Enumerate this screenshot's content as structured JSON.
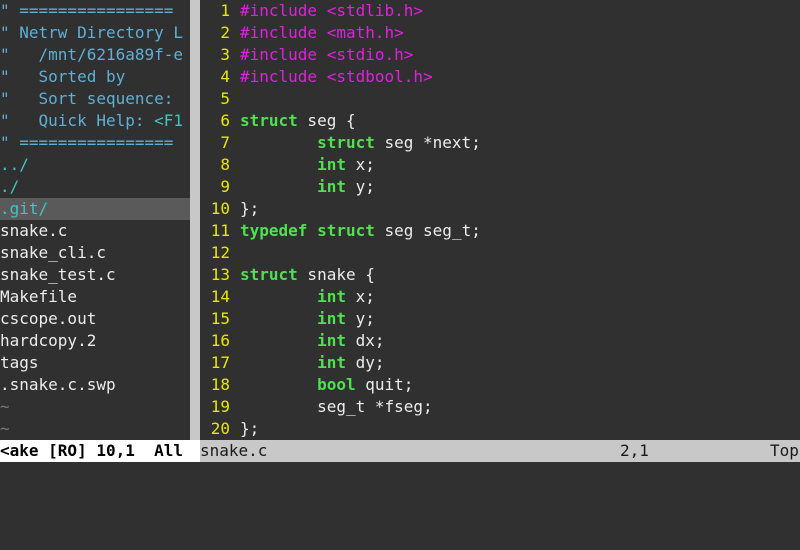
{
  "netrw": {
    "header_lines": [
      "\" ================",
      "\" Netrw Directory L",
      "\"   /mnt/6216a89f-e",
      "\"   Sorted by",
      "\"   Sort sequence:",
      "\"   Quick Help: ",
      "\" ================"
    ],
    "quick_help_key": "<F1",
    "entries": [
      {
        "name": "../",
        "kind": "dir"
      },
      {
        "name": "./",
        "kind": "dir"
      },
      {
        "name": ".git/",
        "kind": "dir",
        "selected": true
      },
      {
        "name": "snake.c",
        "kind": "file"
      },
      {
        "name": "snake_cli.c",
        "kind": "file"
      },
      {
        "name": "snake_test.c",
        "kind": "file"
      },
      {
        "name": "Makefile",
        "kind": "file"
      },
      {
        "name": "cscope.out",
        "kind": "file"
      },
      {
        "name": "hardcopy.2",
        "kind": "file"
      },
      {
        "name": "tags",
        "kind": "file"
      },
      {
        "name": ".snake.c.swp",
        "kind": "file"
      }
    ],
    "tildes": [
      "~",
      "~"
    ]
  },
  "editor": {
    "lines": [
      {
        "n": "1",
        "tokens": [
          {
            "t": "#include",
            "c": "pre"
          },
          {
            "t": " ",
            "c": "norm"
          },
          {
            "t": "<stdlib.h>",
            "c": "str"
          }
        ]
      },
      {
        "n": "2",
        "tokens": [
          {
            "t": "#include",
            "c": "pre"
          },
          {
            "t": " ",
            "c": "norm"
          },
          {
            "t": "<math.h>",
            "c": "str"
          }
        ]
      },
      {
        "n": "3",
        "tokens": [
          {
            "t": "#include",
            "c": "pre"
          },
          {
            "t": " ",
            "c": "norm"
          },
          {
            "t": "<stdio.h>",
            "c": "str"
          }
        ]
      },
      {
        "n": "4",
        "tokens": [
          {
            "t": "#include",
            "c": "pre"
          },
          {
            "t": " ",
            "c": "norm"
          },
          {
            "t": "<stdbool.h>",
            "c": "str"
          }
        ]
      },
      {
        "n": "5",
        "tokens": []
      },
      {
        "n": "6",
        "tokens": [
          {
            "t": "struct",
            "c": "kw"
          },
          {
            "t": " seg {",
            "c": "norm"
          }
        ]
      },
      {
        "n": "7",
        "tokens": [
          {
            "t": "        ",
            "c": "norm"
          },
          {
            "t": "struct",
            "c": "kw"
          },
          {
            "t": " seg *next;",
            "c": "norm"
          }
        ]
      },
      {
        "n": "8",
        "tokens": [
          {
            "t": "        ",
            "c": "norm"
          },
          {
            "t": "int",
            "c": "ty"
          },
          {
            "t": " x;",
            "c": "norm"
          }
        ]
      },
      {
        "n": "9",
        "tokens": [
          {
            "t": "        ",
            "c": "norm"
          },
          {
            "t": "int",
            "c": "ty"
          },
          {
            "t": " y;",
            "c": "norm"
          }
        ]
      },
      {
        "n": "10",
        "tokens": [
          {
            "t": "};",
            "c": "norm"
          }
        ]
      },
      {
        "n": "11",
        "tokens": [
          {
            "t": "typedef",
            "c": "kw"
          },
          {
            "t": " ",
            "c": "norm"
          },
          {
            "t": "struct",
            "c": "kw"
          },
          {
            "t": " seg seg_t;",
            "c": "norm"
          }
        ]
      },
      {
        "n": "12",
        "tokens": []
      },
      {
        "n": "13",
        "tokens": [
          {
            "t": "struct",
            "c": "kw"
          },
          {
            "t": " snake {",
            "c": "norm"
          }
        ]
      },
      {
        "n": "14",
        "tokens": [
          {
            "t": "        ",
            "c": "norm"
          },
          {
            "t": "int",
            "c": "ty"
          },
          {
            "t": " x;",
            "c": "norm"
          }
        ]
      },
      {
        "n": "15",
        "tokens": [
          {
            "t": "        ",
            "c": "norm"
          },
          {
            "t": "int",
            "c": "ty"
          },
          {
            "t": " y;",
            "c": "norm"
          }
        ]
      },
      {
        "n": "16",
        "tokens": [
          {
            "t": "        ",
            "c": "norm"
          },
          {
            "t": "int",
            "c": "ty"
          },
          {
            "t": " dx;",
            "c": "norm"
          }
        ]
      },
      {
        "n": "17",
        "tokens": [
          {
            "t": "        ",
            "c": "norm"
          },
          {
            "t": "int",
            "c": "ty"
          },
          {
            "t": " dy;",
            "c": "norm"
          }
        ]
      },
      {
        "n": "18",
        "tokens": [
          {
            "t": "        ",
            "c": "norm"
          },
          {
            "t": "bool",
            "c": "ty"
          },
          {
            "t": " quit;",
            "c": "norm"
          }
        ]
      },
      {
        "n": "19",
        "tokens": [
          {
            "t": "        seg_t *fseg;",
            "c": "norm"
          }
        ]
      },
      {
        "n": "20",
        "tokens": [
          {
            "t": "};",
            "c": "norm"
          }
        ]
      }
    ]
  },
  "statusline": {
    "left": "<ake [RO] 10,1  All",
    "right_file": "snake.c",
    "right_pos": "2,1",
    "right_pct": "Top"
  },
  "colors": {
    "background": "#303030",
    "line_number": "#e8e800",
    "preprocessor": "#e020e0",
    "keyword": "#50e050",
    "directory": "#40c4c4",
    "netrw_header": "#5fafd7"
  }
}
